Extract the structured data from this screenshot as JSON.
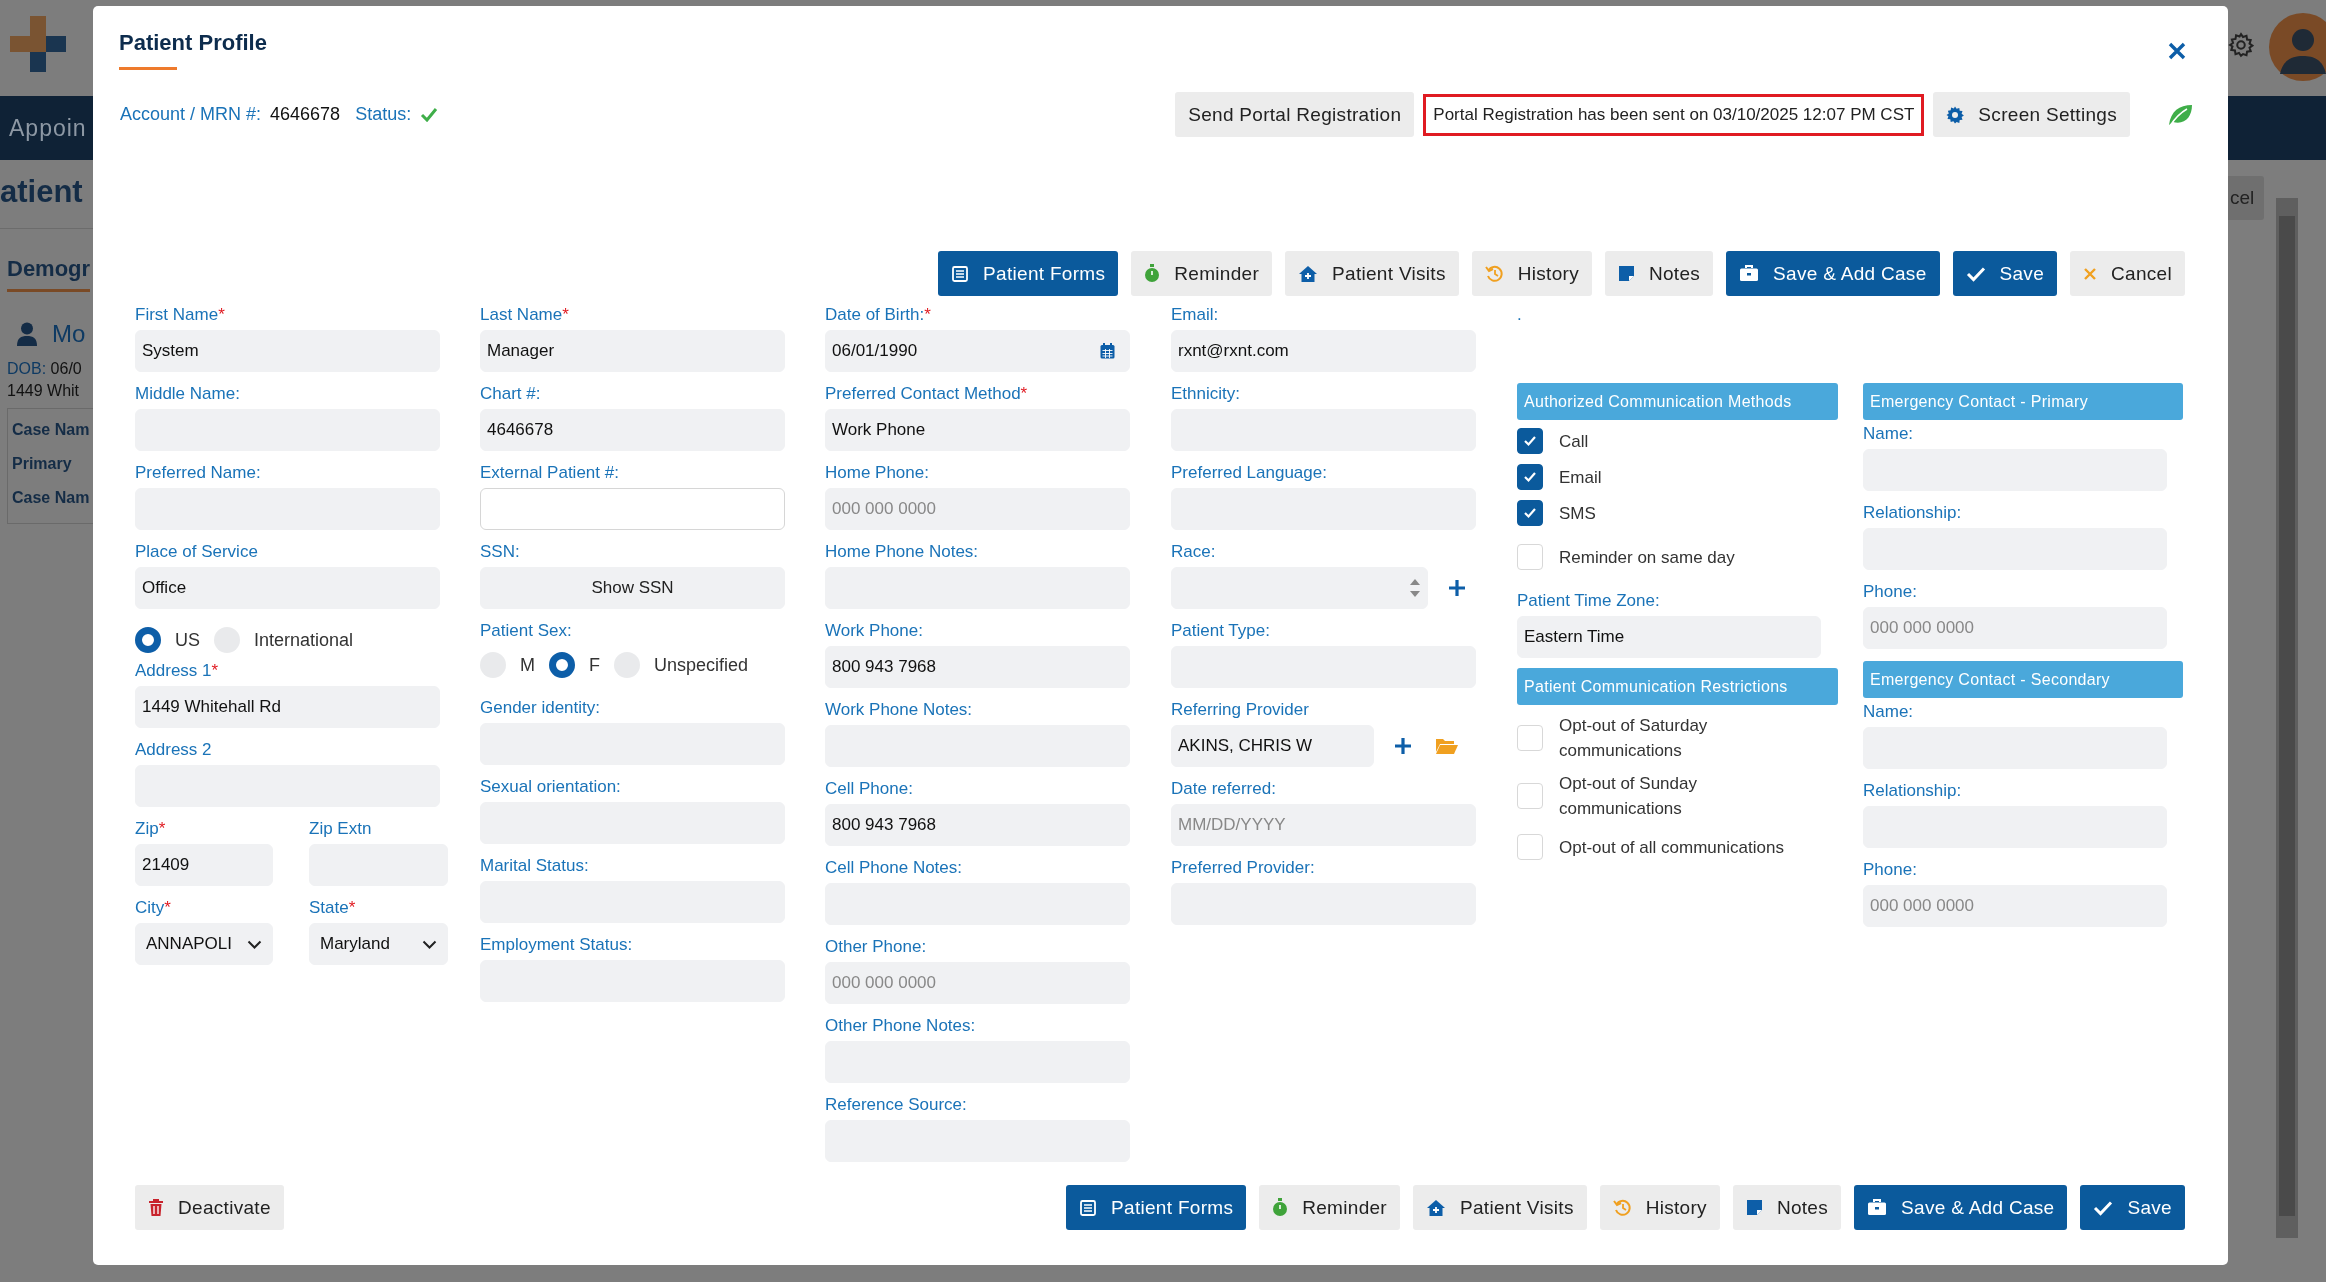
{
  "background": {
    "nav_text": "Appoin",
    "page_title": "atient",
    "section_title": "Demogr",
    "patient_name": "Mo",
    "dob_label": "DOB:",
    "dob_value": "06/0",
    "address": "1449 Whit",
    "case_rows": [
      "Case Nam",
      "Primary",
      "Case Nam"
    ],
    "right_button": "cel"
  },
  "required_mark": "*",
  "modal": {
    "title": "Patient Profile",
    "account_label": "Account / MRN #:",
    "account_value": "4646678",
    "status_label": "Status:",
    "send_portal": "Send Portal Registration",
    "portal_notice": "Portal Registration has been sent on 03/10/2025 12:07 PM CST",
    "screen_settings": "Screen Settings"
  },
  "toolbar": [
    {
      "kind": "forms",
      "label": "Patient Forms"
    },
    {
      "kind": "reminder",
      "label": "Reminder"
    },
    {
      "kind": "visits",
      "label": "Patient Visits"
    },
    {
      "kind": "history",
      "label": "History"
    },
    {
      "kind": "notes",
      "label": "Notes"
    },
    {
      "kind": "save_add_case",
      "label": "Save & Add Case"
    },
    {
      "kind": "save",
      "label": "Save"
    },
    {
      "kind": "cancel",
      "label": "Cancel"
    }
  ],
  "columns": [
    [
      {
        "kind": "text",
        "label": "First Name",
        "required": true,
        "value": "System"
      },
      {
        "kind": "text",
        "label": "Middle Name:",
        "required": false
      },
      {
        "kind": "text",
        "label": "Preferred Name:",
        "required": false
      },
      {
        "kind": "text",
        "label": "Place of Service",
        "required": false,
        "value": "Office"
      },
      {
        "kind": "radios",
        "options": [
          {
            "label": "US",
            "selected": true
          },
          {
            "label": "International",
            "selected": false
          }
        ]
      },
      {
        "kind": "text",
        "label": "Address 1",
        "required": true,
        "value": "1449 Whitehall Rd"
      },
      {
        "kind": "text",
        "label": "Address 2",
        "required": false
      },
      {
        "kind": "pair",
        "items": [
          {
            "kind": "text",
            "label": "Zip",
            "required": true,
            "value": "21409"
          },
          {
            "kind": "text",
            "label": "Zip Extn",
            "required": false
          }
        ]
      },
      {
        "kind": "pair",
        "items": [
          {
            "kind": "select",
            "label": "City",
            "required": true,
            "value": "ANNAPOLI"
          },
          {
            "kind": "select",
            "label": "State",
            "required": true,
            "value": "Maryland"
          }
        ]
      }
    ],
    [
      {
        "kind": "text",
        "label": "Last Name",
        "required": true,
        "value": "Manager"
      },
      {
        "kind": "text",
        "label": "Chart #:",
        "required": false,
        "value": "4646678"
      },
      {
        "kind": "outlined",
        "label": "External Patient #:",
        "required": false
      },
      {
        "kind": "button",
        "label": "SSN:",
        "required": false,
        "value": "Show SSN"
      },
      {
        "kind": "radios",
        "label": "Patient Sex:",
        "options": [
          {
            "label": "M",
            "selected": false
          },
          {
            "label": "F",
            "selected": true
          },
          {
            "label": "Unspecified",
            "selected": false
          }
        ]
      },
      {
        "kind": "text",
        "label": "Gender identity:",
        "required": false
      },
      {
        "kind": "text",
        "label": "Sexual orientation:",
        "required": false
      },
      {
        "kind": "text",
        "label": "Marital Status:",
        "required": false
      },
      {
        "kind": "text",
        "label": "Employment Status:",
        "required": false
      }
    ],
    [
      {
        "kind": "date",
        "label": "Date of Birth:",
        "required": true,
        "value": "06/01/1990"
      },
      {
        "kind": "text",
        "label": "Preferred Contact Method",
        "required": true,
        "value": "Work Phone"
      },
      {
        "kind": "text",
        "label": "Home Phone:",
        "required": false,
        "placeholder": "000 000 0000"
      },
      {
        "kind": "text",
        "label": "Home Phone Notes:",
        "required": false
      },
      {
        "kind": "text",
        "label": "Work Phone:",
        "required": false,
        "value": "800 943 7968"
      },
      {
        "kind": "text",
        "label": "Work Phone Notes:",
        "required": false
      },
      {
        "kind": "text",
        "label": "Cell Phone:",
        "required": false,
        "value": "800 943 7968"
      },
      {
        "kind": "text",
        "label": "Cell Phone Notes:",
        "required": false
      },
      {
        "kind": "text",
        "label": "Other Phone:",
        "required": false,
        "placeholder": "000 000 0000"
      },
      {
        "kind": "text",
        "label": "Other Phone Notes:",
        "required": false
      },
      {
        "kind": "text",
        "label": "Reference Source:",
        "required": false
      }
    ],
    [
      {
        "kind": "text",
        "label": "Email:",
        "required": false,
        "value": "rxnt@rxnt.com"
      },
      {
        "kind": "text",
        "label": "Ethnicity:",
        "required": false
      },
      {
        "kind": "text",
        "label": "Preferred Language:",
        "required": false
      },
      {
        "kind": "spinner",
        "label": "Race:",
        "required": false
      },
      {
        "kind": "text",
        "label": "Patient Type:",
        "required": false
      },
      {
        "kind": "provider",
        "label": "Referring Provider",
        "required": false,
        "value": "AKINS, CHRIS W"
      },
      {
        "kind": "text",
        "label": "Date referred:",
        "required": false,
        "placeholder": "MM/DD/YYYY"
      },
      {
        "kind": "text",
        "label": "Preferred Provider:",
        "required": false
      }
    ],
    [
      {
        "kind": "note",
        "label": "."
      },
      {
        "kind": "header",
        "label": "Authorized Communication Methods"
      },
      {
        "kind": "checkbox",
        "label": "Call",
        "checked": true
      },
      {
        "kind": "checkbox",
        "label": "Email",
        "checked": true
      },
      {
        "kind": "checkbox",
        "label": "SMS",
        "checked": true
      },
      {
        "kind": "checkbox",
        "label": "Reminder on same day",
        "checked": false
      },
      {
        "kind": "text",
        "label": "Patient Time Zone:",
        "required": false,
        "value": "Eastern Time"
      },
      {
        "kind": "header",
        "label": "Patient Communication Restrictions"
      },
      {
        "kind": "checkbox",
        "label": "Opt-out of Saturday communications",
        "checked": false
      },
      {
        "kind": "checkbox",
        "label": "Opt-out of Sunday communications",
        "checked": false
      },
      {
        "kind": "checkbox",
        "label": "Opt-out of all communications",
        "checked": false
      }
    ],
    [
      {
        "kind": "header",
        "label": "Emergency Contact - Primary"
      },
      {
        "kind": "text",
        "label": "Name:",
        "required": false
      },
      {
        "kind": "text",
        "label": "Relationship:",
        "required": false
      },
      {
        "kind": "text",
        "label": "Phone:",
        "required": false,
        "placeholder": "000 000 0000"
      },
      {
        "kind": "header",
        "label": "Emergency Contact - Secondary"
      },
      {
        "kind": "text",
        "label": "Name:",
        "required": false
      },
      {
        "kind": "text",
        "label": "Relationship:",
        "required": false
      },
      {
        "kind": "text",
        "label": "Phone:",
        "required": false,
        "placeholder": "000 000 0000"
      }
    ]
  ],
  "bottom_bar": {
    "deactivate": {
      "kind": "deactivate",
      "label": "Deactivate"
    },
    "buttons": [
      {
        "kind": "forms",
        "label": "Patient Forms"
      },
      {
        "kind": "reminder",
        "label": "Reminder"
      },
      {
        "kind": "visits",
        "label": "Patient Visits"
      },
      {
        "kind": "history",
        "label": "History"
      },
      {
        "kind": "notes",
        "label": "Notes"
      },
      {
        "kind": "save_add_case",
        "label": "Save & Add Case"
      },
      {
        "kind": "save",
        "label": "Save"
      }
    ]
  }
}
